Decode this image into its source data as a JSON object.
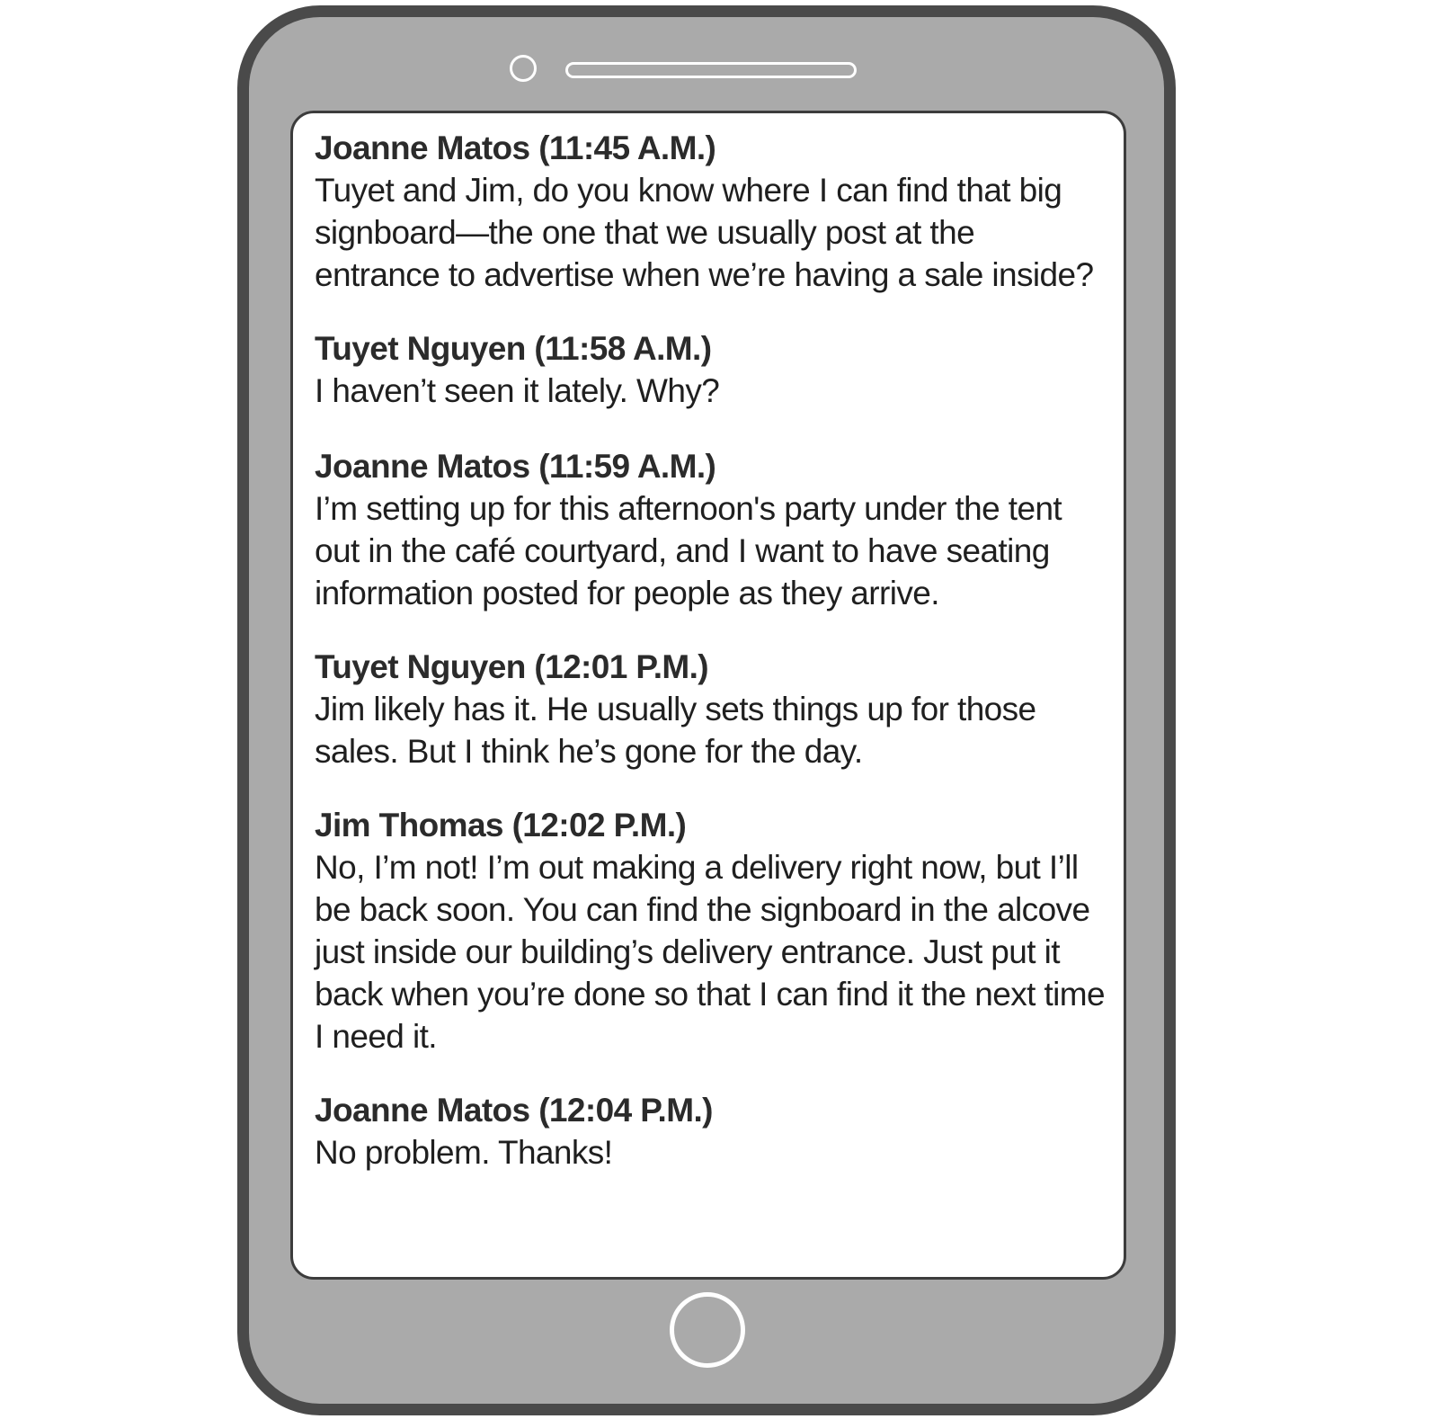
{
  "chat": {
    "messages": [
      {
        "sender": "Joanne Matos (11:45 A.M.)",
        "text": "Tuyet and Jim, do you know where I can find that big signboard—the one that we usually post at the entrance to advertise when we’re having a sale inside?"
      },
      {
        "sender": "Tuyet Nguyen (11:58 A.M.)",
        "text": "I haven’t seen it lately. Why?"
      },
      {
        "sender": "Joanne Matos (11:59 A.M.)",
        "text": "I’m setting up for this afternoon's party under the tent out in the café courtyard, and I want to have seating information posted for people as they arrive."
      },
      {
        "sender": "Tuyet Nguyen (12:01 P.M.)",
        "text": "Jim likely has it. He usually sets things up for those sales. But I think he’s gone for the day."
      },
      {
        "sender": "Jim Thomas (12:02 P.M.)",
        "text": "No, I’m not! I’m out making a delivery right now, but I’ll be back soon. You can find the signboard in the alcove just inside our building’s delivery entrance. Just put it back when you’re done so that I can find it the next time I need it."
      },
      {
        "sender": "Joanne Matos (12:04 P.M.)",
        "text": "No problem. Thanks!"
      }
    ]
  },
  "colors": {
    "phone_body": "#aaaaaa",
    "phone_border": "#4a4a4a",
    "screen": "#ffffff",
    "text": "#1f1f1f"
  },
  "icons": {
    "camera": "camera-icon",
    "speaker": "speaker-icon",
    "home": "home-button"
  }
}
